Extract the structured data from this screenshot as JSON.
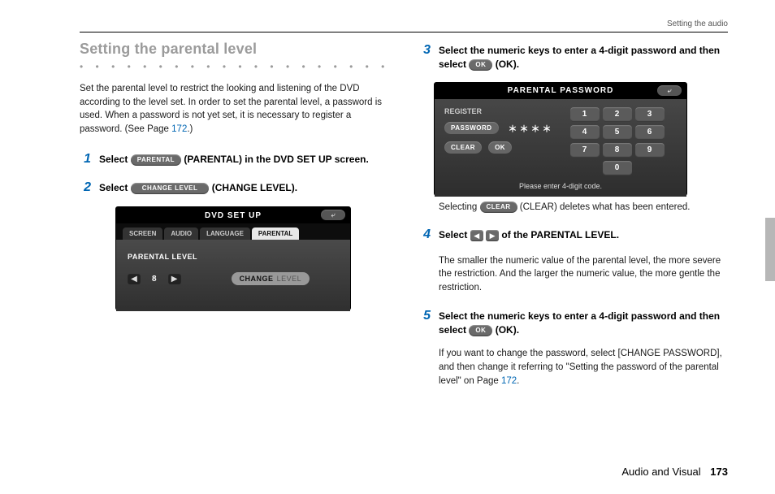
{
  "running_head": "Setting the audio",
  "section_title": "Setting the parental level",
  "dotted_separator": "• • • • • • • • • • • • • • • • • • • • • • • • • • • • • • • • • • • •",
  "intro_text_before": "Set the parental level to restrict the looking and listening of the DVD according to the level set. In order to set the parental level, a password is used. When a password is not yet set, it is necessary to register a password. (See Page ",
  "intro_link": "172",
  "intro_text_after": ".)",
  "steps": {
    "s1": {
      "num": "1",
      "pre": "Select ",
      "pill": "PARENTAL",
      "post": " (PARENTAL) in the DVD SET UP screen."
    },
    "s2": {
      "num": "2",
      "pre": "Select ",
      "pill": "CHANGE  LEVEL",
      "post": " (CHANGE LEVEL)."
    },
    "s3": {
      "num": "3",
      "lead": "Select the numeric keys to enter a 4-digit password and then select ",
      "pill": "OK",
      "post": " (OK)."
    },
    "s3_note_pre": "Selecting ",
    "s3_note_pill": "CLEAR",
    "s3_note_post": " (CLEAR) deletes what has been entered.",
    "s4": {
      "num": "4",
      "pre": "Select ",
      "post": " of the PARENTAL LEVEL."
    },
    "s4_note": "The smaller the numeric value of the parental level, the more severe the restriction. And the larger the numeric value, the more gentle the restriction.",
    "s5": {
      "num": "5",
      "lead": "Select the numeric keys to enter a 4-digit password and then select ",
      "pill": "OK",
      "post": " (OK)."
    },
    "s5_note_before": "If you want to change the password, select [CHANGE PASSWORD], and then change it referring to \"Setting the password of the parental level\" on Page ",
    "s5_note_link": "172",
    "s5_note_after": "."
  },
  "screen1": {
    "title": "DVD SET UP",
    "back": "⤶",
    "tabs": [
      "SCREEN",
      "AUDIO",
      "LANGUAGE",
      "PARENTAL"
    ],
    "level_label": "PARENTAL LEVEL",
    "level_value": "8",
    "change_btn": "CHANGE",
    "change_dim": "LEVEL"
  },
  "screen2": {
    "title": "PARENTAL PASSWORD",
    "back": "⤶",
    "register": "REGISTER",
    "password_btn": "PASSWORD",
    "password_field": "＊＊＊＊",
    "clear_btn": "CLEAR",
    "ok_btn": "OK",
    "keys": [
      "1",
      "2",
      "3",
      "4",
      "5",
      "6",
      "7",
      "8",
      "9",
      "0"
    ],
    "msg": "Please enter 4-digit code."
  },
  "footer": {
    "chapter": "Audio and Visual",
    "page": "173"
  }
}
